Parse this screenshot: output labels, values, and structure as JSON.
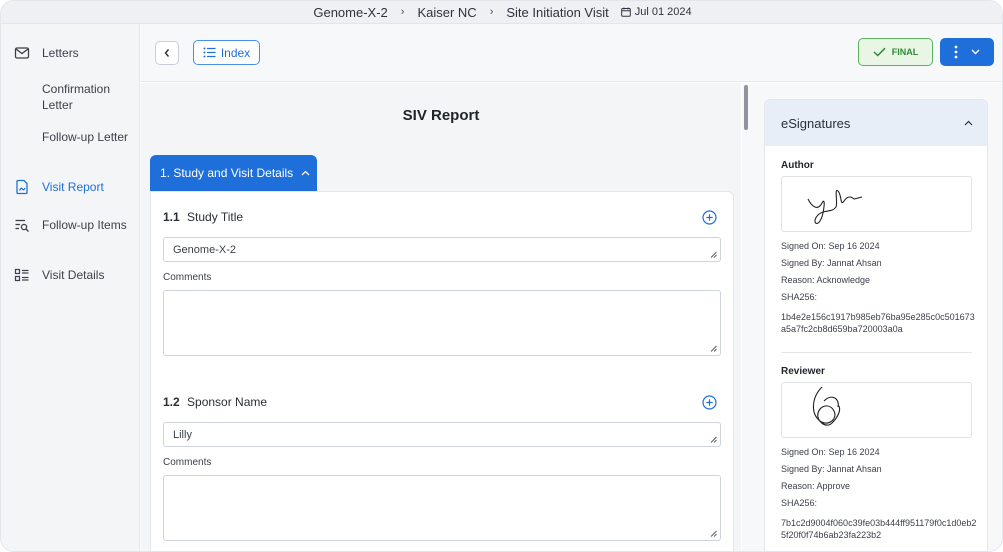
{
  "breadcrumb": {
    "study": "Genome-X-2",
    "site": "Kaiser NC",
    "visit": "Site Initiation Visit",
    "date": "Jul 01 2024"
  },
  "sidebar": {
    "items": [
      {
        "label": "Letters",
        "icon": "envelope-icon"
      },
      {
        "label": "Confirmation Letter",
        "icon": ""
      },
      {
        "label": "Follow-up Letter",
        "icon": ""
      },
      {
        "label": "Visit Report",
        "icon": "report-icon",
        "active": true
      },
      {
        "label": "Follow-up Items",
        "icon": "list-search-icon"
      },
      {
        "label": "Visit Details",
        "icon": "details-list-icon"
      }
    ]
  },
  "header": {
    "index_label": "Index",
    "final_label": "FINAL"
  },
  "report": {
    "title": "SIV Report",
    "section_label": "1. Study and Visit Details",
    "fields": [
      {
        "number": "1.1",
        "label": "Study Title",
        "value": "Genome-X-2",
        "comments_label": "Comments"
      },
      {
        "number": "1.2",
        "label": "Sponsor Name",
        "value": "Lilly",
        "comments_label": "Comments"
      }
    ]
  },
  "signatures": {
    "title": "eSignatures",
    "entries": [
      {
        "role": "Author",
        "signed_on": "Signed On:  Sep 16 2024",
        "signed_by": "Signed By:  Jannat Ahsan",
        "reason": "Reason:  Acknowledge",
        "sha_label": "SHA256:",
        "sha": "1b4e2e156c1917b985eb76ba95e285c0c501673a5a7fc2cb8d659ba720003a0a"
      },
      {
        "role": "Reviewer",
        "signed_on": "Signed On:  Sep 16 2024",
        "signed_by": "Signed By:  Jannat Ahsan",
        "reason": "Reason:  Approve",
        "sha_label": "SHA256:",
        "sha": "7b1c2d9004f060c39fe03b444ff951179f0c1d0eb25f20f0f74b6ab23fa223b2"
      }
    ]
  },
  "colors": {
    "accent": "#1e6fd9",
    "final_green": "#2e8a33",
    "sidebar_bg": "#f4f5f7"
  }
}
